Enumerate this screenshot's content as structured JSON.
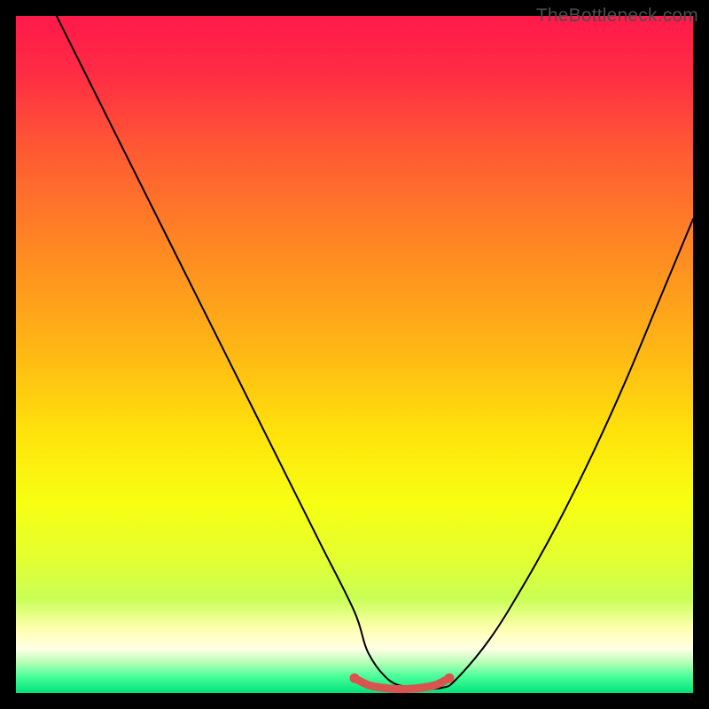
{
  "watermark": "TheBottleneck.com",
  "colors": {
    "gradient_stops": [
      {
        "offset": 0.0,
        "color": "#ff1a4b"
      },
      {
        "offset": 0.08,
        "color": "#ff2a44"
      },
      {
        "offset": 0.2,
        "color": "#ff5a33"
      },
      {
        "offset": 0.35,
        "color": "#ff8a22"
      },
      {
        "offset": 0.5,
        "color": "#ffb914"
      },
      {
        "offset": 0.62,
        "color": "#ffe40b"
      },
      {
        "offset": 0.72,
        "color": "#f7ff12"
      },
      {
        "offset": 0.8,
        "color": "#e4ff30"
      },
      {
        "offset": 0.86,
        "color": "#c9ff55"
      },
      {
        "offset": 0.905,
        "color": "#ffffb0"
      },
      {
        "offset": 0.935,
        "color": "#ffffe6"
      },
      {
        "offset": 0.955,
        "color": "#b6ffb6"
      },
      {
        "offset": 0.975,
        "color": "#4bff9a"
      },
      {
        "offset": 1.0,
        "color": "#00e27a"
      }
    ],
    "curve": "#000000",
    "marker": "#d9544f",
    "frame_bg": "#000000"
  },
  "chart_data": {
    "type": "line",
    "title": "",
    "xlabel": "",
    "ylabel": "",
    "xlim": [
      0,
      100
    ],
    "ylim": [
      0,
      100
    ],
    "grid": false,
    "legend": false,
    "series": [
      {
        "name": "bottleneck-curve",
        "x": [
          0,
          5,
          10,
          15,
          20,
          25,
          30,
          35,
          40,
          45,
          50,
          52,
          55,
          58,
          60,
          63,
          65,
          70,
          75,
          80,
          85,
          90,
          95,
          100
        ],
        "y": [
          112,
          102,
          92,
          82,
          72,
          62,
          52,
          42,
          32,
          22,
          12,
          6,
          2,
          0.8,
          0.6,
          0.8,
          2,
          8,
          16,
          25,
          35,
          46,
          58,
          70
        ]
      }
    ],
    "highlight_segment": {
      "x": [
        50,
        52,
        54,
        56,
        58,
        60,
        62,
        64
      ],
      "y": [
        2.2,
        1.2,
        0.8,
        0.6,
        0.6,
        0.8,
        1.2,
        2.2
      ]
    },
    "annotations": []
  }
}
